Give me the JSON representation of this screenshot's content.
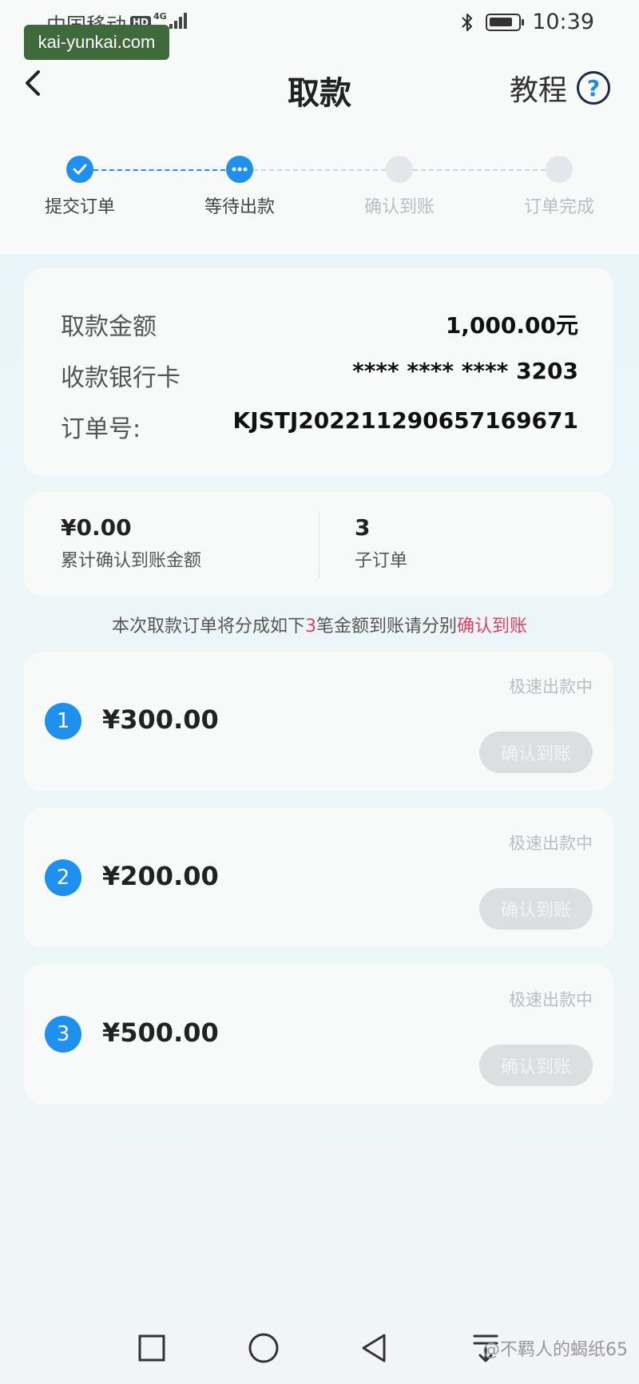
{
  "status_bar": {
    "carrier": "中国移动",
    "hd": "HD",
    "network": "4G",
    "time": "10:39"
  },
  "watermark_top": "kai-yunkai.com",
  "header": {
    "title": "取款",
    "tutorial_label": "教程",
    "help_glyph": "?"
  },
  "steps": [
    {
      "label": "提交订单",
      "state": "done"
    },
    {
      "label": "等待出款",
      "state": "active"
    },
    {
      "label": "确认到账",
      "state": "pending"
    },
    {
      "label": "订单完成",
      "state": "pending"
    }
  ],
  "info": {
    "amount_label": "取款金额",
    "amount_value": "1,000.00元",
    "card_label": "收款银行卡",
    "card_value": "**** **** **** 3203",
    "order_label": "订单号:",
    "order_value": "KJSTJ20221129065716967​1"
  },
  "summary": {
    "confirmed_value": "¥0.00",
    "confirmed_label": "累计确认到账金额",
    "suborders_value": "3",
    "suborders_label": "子订单"
  },
  "notice": {
    "prefix": "本次取款订单将分成如下",
    "count": "3",
    "middle": "笔金额到账请分别",
    "highlight": "确认到账"
  },
  "sub_orders": [
    {
      "index": "1",
      "amount": "¥300.00",
      "status": "极速出款中",
      "button": "确认到账"
    },
    {
      "index": "2",
      "amount": "¥200.00",
      "status": "极速出款中",
      "button": "确认到账"
    },
    {
      "index": "3",
      "amount": "¥500.00",
      "status": "极速出款中",
      "button": "确认到账"
    }
  ],
  "watermark_bottom": "@不羁人的蝎纸65",
  "colors": {
    "accent": "#1e90ef",
    "highlight_red": "#e0405a",
    "disabled_button": "#dcdee0"
  },
  "icons": {
    "back": "back-arrow-icon",
    "help": "help-icon",
    "nav": [
      "recents-icon",
      "home-icon",
      "back-icon",
      "download-menu-icon"
    ]
  }
}
